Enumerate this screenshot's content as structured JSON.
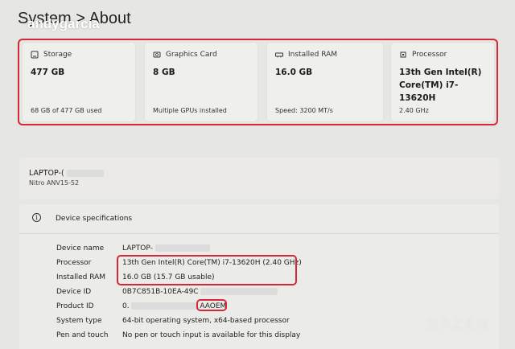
{
  "header": {
    "breadcrumb": "System  >  About",
    "watermark": "andygarcia"
  },
  "cards": [
    {
      "label": "Storage",
      "value": "477 GB",
      "sub": "68 GB of 477 GB used",
      "icon": "storage-icon"
    },
    {
      "label": "Graphics Card",
      "value": "8 GB",
      "sub": "Multiple GPUs installed",
      "icon": "graphics-card-icon"
    },
    {
      "label": "Installed RAM",
      "value": "16.0 GB",
      "sub": "Speed: 3200 MT/s",
      "icon": "ram-icon"
    },
    {
      "label": "Processor",
      "value": "13th Gen Intel(R) Core(TM) i7-13620H",
      "sub": "2.40 GHz",
      "icon": "processor-icon"
    }
  ],
  "device": {
    "name": "LAPTOP-(",
    "model": "Nitro ANV15-52"
  },
  "specs": {
    "title": "Device specifications",
    "rows": [
      {
        "label": "Device name",
        "value": "LAPTOP-"
      },
      {
        "label": "Processor",
        "value": "13th Gen Intel(R) Core(TM) i7-13620H (2.40 GHz)"
      },
      {
        "label": "Installed RAM",
        "value": "16.0 GB (15.7 GB usable)"
      },
      {
        "label": "Device ID",
        "value": "0B7C851B-10EA-49C"
      },
      {
        "label": "Product ID",
        "value": "0.",
        "value_suffix": "AAOEM"
      },
      {
        "label": "System type",
        "value": "64-bit operating system, x64-based processor"
      },
      {
        "label": "Pen and touch",
        "value": "No pen or touch input is available for this display"
      }
    ]
  },
  "logo": {
    "text": "BAZAR"
  },
  "colors": {
    "highlight": "#d3283a",
    "background": "#e6e7e3",
    "card": "#efefec"
  }
}
